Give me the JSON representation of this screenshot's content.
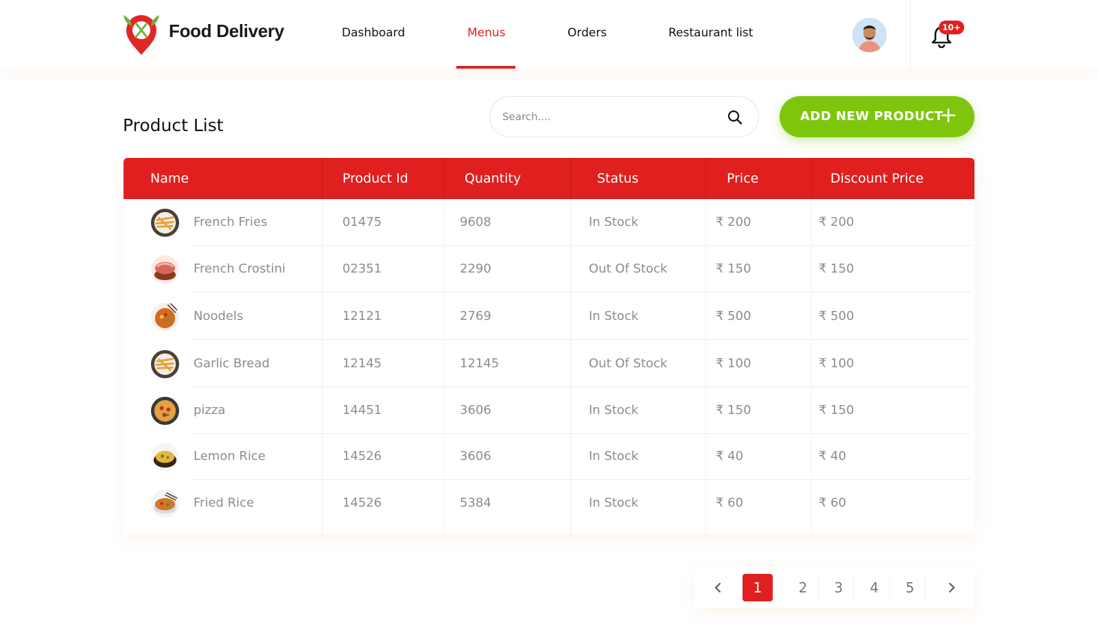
{
  "header": {
    "brand": "Food Delivery",
    "nav": [
      {
        "label": "Dashboard",
        "active": false
      },
      {
        "label": "Menus",
        "active": true
      },
      {
        "label": "Orders",
        "active": false
      },
      {
        "label": "Restaurant list",
        "active": false
      }
    ],
    "notification_badge": "10+"
  },
  "main": {
    "title": "Product List",
    "search": {
      "placeholder": "Search....",
      "value": ""
    },
    "add_button": "ADD NEW PRODUCT"
  },
  "table": {
    "columns": [
      "Name",
      "Product Id",
      "Quantity",
      "Status",
      "Price",
      "Discount Price"
    ],
    "rows": [
      {
        "name": "French Fries",
        "id": "01475",
        "qty": "9608",
        "status": "In Stock",
        "price": "₹ 200",
        "discount": "₹ 200",
        "thumb": "fries"
      },
      {
        "name": "French Crostini",
        "id": "02351",
        "qty": "2290",
        "status": "Out Of Stock",
        "price": "₹ 150",
        "discount": "₹ 150",
        "thumb": "crostini"
      },
      {
        "name": "Noodels",
        "id": "12121",
        "qty": "2769",
        "status": "In Stock",
        "price": "₹ 500",
        "discount": "₹ 500",
        "thumb": "noodles"
      },
      {
        "name": "Garlic Bread",
        "id": "12145",
        "qty": "12145",
        "status": "Out Of Stock",
        "price": "₹ 100",
        "discount": "₹ 100",
        "thumb": "fries"
      },
      {
        "name": "pizza",
        "id": "14451",
        "qty": "3606",
        "status": "In Stock",
        "price": "₹ 150",
        "discount": "₹ 150",
        "thumb": "pizza"
      },
      {
        "name": "Lemon Rice",
        "id": "14526",
        "qty": "3606",
        "status": "In Stock",
        "price": "₹ 40",
        "discount": "₹ 40",
        "thumb": "lemonrice"
      },
      {
        "name": "Fried Rice",
        "id": "14526",
        "qty": "5384",
        "status": "In Stock",
        "price": "₹ 60",
        "discount": "₹ 60",
        "thumb": "friedrice"
      }
    ]
  },
  "pagination": {
    "pages": [
      "1",
      "2",
      "3",
      "4",
      "5"
    ],
    "current": "1"
  },
  "colors": {
    "primary_red": "#e01f1f",
    "accent_green": "#7ec60e"
  },
  "icons": {
    "search": "search-icon",
    "add": "plus-icon",
    "notification": "bell-icon",
    "prev": "chevron-left-icon",
    "next": "chevron-right-icon"
  }
}
